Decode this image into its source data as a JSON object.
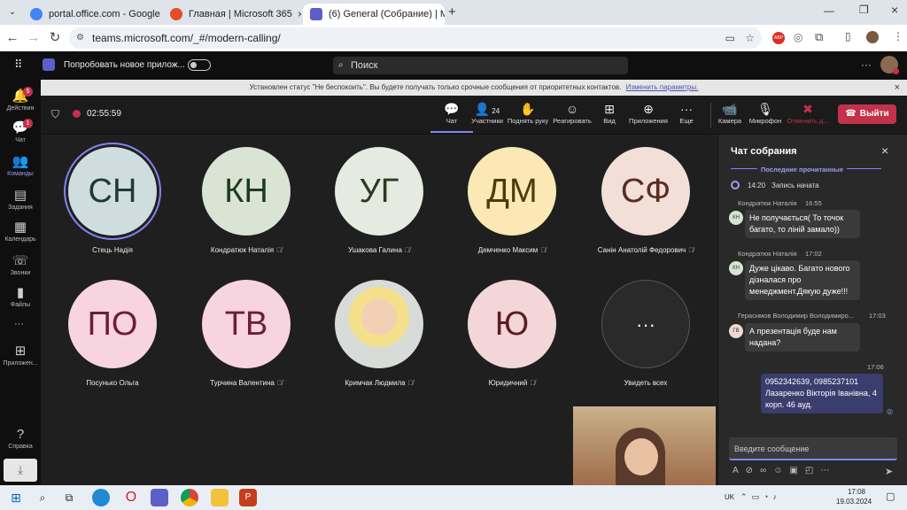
{
  "browser": {
    "tabs": [
      {
        "title": "portal.office.com - Google Sear",
        "fav_color": "#4285f4"
      },
      {
        "title": "Главная | Microsoft 365",
        "fav_color": "#e44d26"
      },
      {
        "title": "(6) General (Собрание) | M",
        "fav_color": "#5b5fc7"
      }
    ],
    "url": "teams.microsoft.com/_#/modern-calling/"
  },
  "teams": {
    "try_new": "Попробовать новое прилож...",
    "search_placeholder": "Поиск",
    "notice": "Установлен статус \"Не беспокоить\". Вы будете получать только срочные сообщения от приоритетных контактов.",
    "notice_link": "Изменить параметры.",
    "rail": [
      {
        "label": "Действия",
        "icon": "bell-icon",
        "badge": "5"
      },
      {
        "label": "Чат",
        "icon": "chat-icon",
        "badge": "1"
      },
      {
        "label": "Команды",
        "icon": "teams-icon",
        "badge": ""
      },
      {
        "label": "Задания",
        "icon": "assignments-icon",
        "badge": ""
      },
      {
        "label": "Календарь",
        "icon": "calendar-icon",
        "badge": ""
      },
      {
        "label": "Звонки",
        "icon": "phone-icon",
        "badge": ""
      },
      {
        "label": "Файлы",
        "icon": "files-icon",
        "badge": ""
      },
      {
        "label": "Приложен...",
        "icon": "apps-icon",
        "badge": ""
      },
      {
        "label": "Справка",
        "icon": "help-icon",
        "badge": ""
      }
    ]
  },
  "meeting": {
    "timer": "02:55:59",
    "participants_count": "24",
    "toolbar": {
      "chat": "Чат",
      "participants": "Участники",
      "raise_hand": "Поднять руку",
      "react": "Реагировать",
      "view": "Вид",
      "apps": "Приложения",
      "more": "Еще",
      "camera": "Камера",
      "mic": "Микрофон",
      "share": "Отменить д...",
      "leave": "Выйти"
    },
    "tiles": [
      {
        "initials": "СН",
        "name": "Стець Надія",
        "bg": "#cfdddf",
        "fg": "#1e3a3a",
        "muted": false
      },
      {
        "initials": "КН",
        "name": "Кондратюк Наталія",
        "bg": "#d9e4d5",
        "fg": "#1f3a1c",
        "muted": true
      },
      {
        "initials": "УГ",
        "name": "Ушакова Галина",
        "bg": "#e5ebe0",
        "fg": "#2c3a22",
        "muted": true
      },
      {
        "initials": "ДМ",
        "name": "Демченко Максим",
        "bg": "#fbe8b4",
        "fg": "#4a3b0e",
        "muted": true
      },
      {
        "initials": "СФ",
        "name": "Санін Анатолій Федорович",
        "bg": "#f2dfd8",
        "fg": "#5a2c22",
        "muted": true
      },
      {
        "initials": "ПО",
        "name": "Посунько Ольга",
        "bg": "#f7d4e0",
        "fg": "#6b1e3c",
        "muted": false
      },
      {
        "initials": "ТВ",
        "name": "Турчина Валентина",
        "bg": "#f7d4e0",
        "fg": "#6b1e3c",
        "muted": true
      },
      {
        "initials": "",
        "name": "Кримчак Людмила",
        "bg": "#8a7a6a",
        "fg": "#ffffff",
        "muted": true
      },
      {
        "initials": "Ю",
        "name": "Юридичний",
        "bg": "#f2d6d8",
        "fg": "#5a1e22",
        "muted": true
      },
      {
        "initials": "···",
        "name": "Увидеть всех",
        "bg": "#2a2a2a",
        "fg": "#ffffff",
        "muted": false
      }
    ]
  },
  "chat": {
    "title": "Чат собрания",
    "last_read": "Последние прочитанные",
    "recording_time": "14:20",
    "recording_text": "Запись начата",
    "messages": [
      {
        "author": "Кондратюк Наталія",
        "time": "16:55",
        "initials": "КН",
        "text": "Не получається( То точок багато, то ліній замало))"
      },
      {
        "author": "Кондратюк Наталія",
        "time": "17:02",
        "initials": "КН",
        "text": "Дуже цікаво. Багато нового дізналася про менеджмент.Дякую дуже!!!"
      },
      {
        "author": "Герасимов Володимир Володимиро...",
        "time": "17:03",
        "initials": "ГВ",
        "text": "А презентація буде нам надана?"
      }
    ],
    "own_time": "17:06",
    "own_text": "0952342639, 0985237101 Лазаренко Вікторія Іванівна, 4 корп. 46 ауд.",
    "compose_placeholder": "Введите сообщение"
  },
  "taskbar": {
    "lang": "UK",
    "time": "17:08",
    "date": "19.03.2024"
  }
}
